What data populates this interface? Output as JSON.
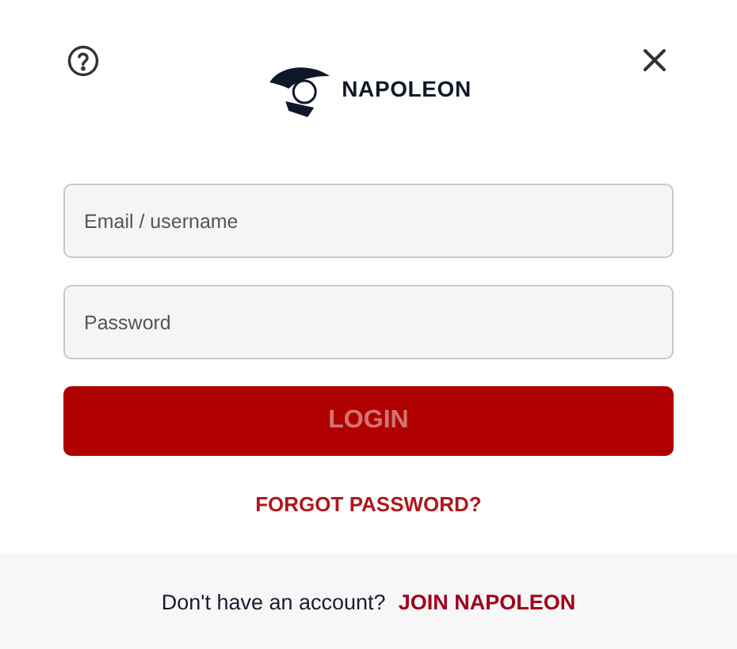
{
  "header": {
    "brand": "NAPOLEON"
  },
  "fields": [
    {
      "placeholder": "Email / username"
    },
    {
      "placeholder": "Password"
    }
  ],
  "login_button": {
    "label": "LOGIN",
    "disabled": true
  },
  "forgot_link": "FORGOT PASSWORD?",
  "footer": {
    "prompt": "Don't have an account?",
    "link": "JOIN NAPOLEON"
  }
}
